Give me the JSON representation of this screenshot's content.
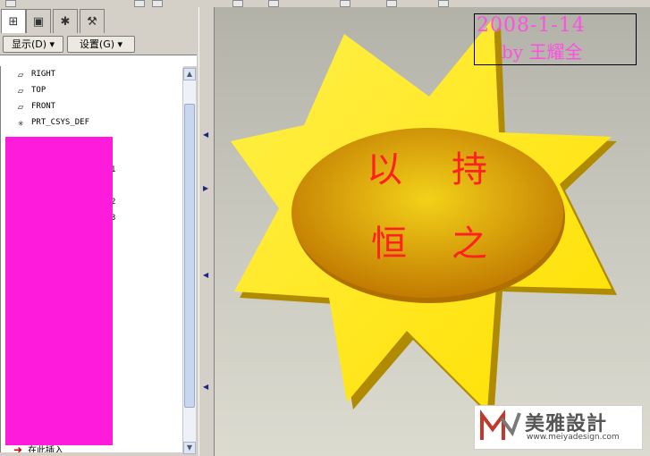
{
  "toolbar": {
    "icons": [
      "save-icon",
      "undo-icon",
      "redo-icon",
      "zoom-icon",
      "repaint-icon",
      "view-icon",
      "orient-icon",
      "datum-plane-icon",
      "datum-axis-icon",
      "datum-point-icon"
    ]
  },
  "tabs": [
    {
      "name": "model-tree-tab",
      "icon": "tree-icon",
      "glyph": "⊞"
    },
    {
      "name": "folder-browser-tab",
      "icon": "folder-icon",
      "glyph": "▣"
    },
    {
      "name": "favorites-tab",
      "icon": "star-icon",
      "glyph": "✱"
    },
    {
      "name": "connections-tab",
      "icon": "tools-icon",
      "glyph": "⚒"
    }
  ],
  "menus": {
    "show": "显示(D)",
    "settings": "设置(G)"
  },
  "tree": {
    "items": [
      {
        "label": "RIGHT",
        "icon": "datum-plane-icon"
      },
      {
        "label": "TOP",
        "icon": "datum-plane-icon"
      },
      {
        "label": "FRONT",
        "icon": "datum-plane-icon"
      },
      {
        "label": "PRT_CSYS_DEF",
        "icon": "coordinate-system-icon"
      }
    ],
    "stray_digits": [
      "1",
      "2",
      "3"
    ],
    "insert_here": "在此插入"
  },
  "graphics": {
    "stamp_date": "2008-1-14",
    "stamp_author": "by 王耀全",
    "model_text": [
      "以",
      "持",
      "恒",
      "之"
    ],
    "watermark": {
      "name": "美雅設計",
      "url": "www.meiyadesign.com"
    }
  },
  "colors": {
    "star_face": "#ffe000",
    "star_side": "#b08a00",
    "oval_center": "#f3d21a",
    "oval_edge": "#c07800",
    "model_text": "#ff2020",
    "stamp": "#ff4fe3",
    "redaction": "#ff1bdb"
  }
}
